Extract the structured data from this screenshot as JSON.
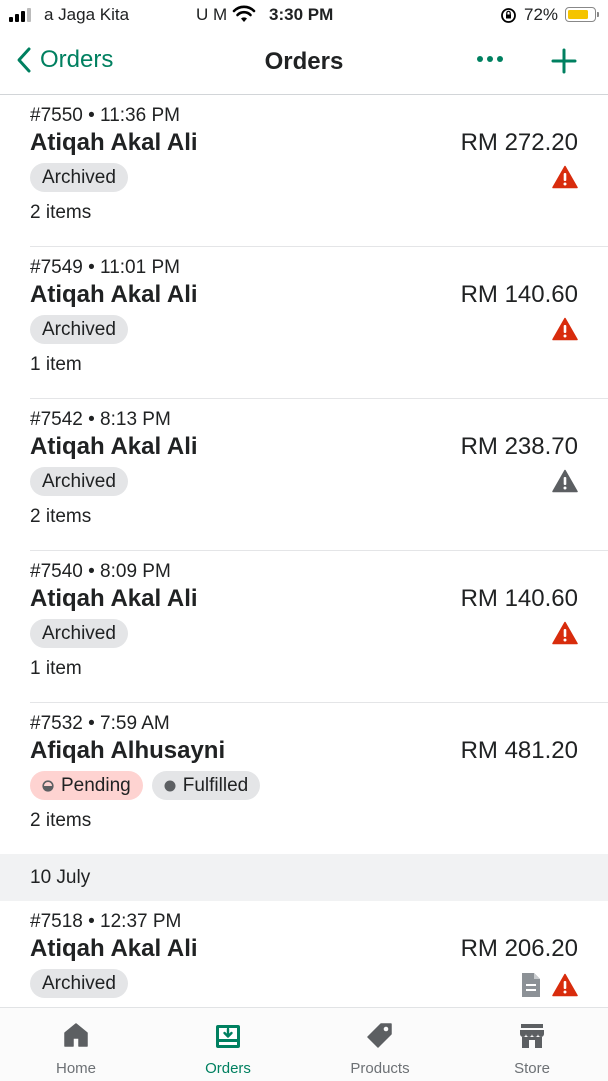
{
  "status_bar": {
    "carrier": "a Jaga Kita",
    "carrier_extra": "U M",
    "time": "3:30 PM",
    "battery": "72%",
    "icons": [
      "signal-icon",
      "wifi-icon",
      "orientation-lock-icon",
      "battery-icon"
    ]
  },
  "nav": {
    "back_label": "Orders",
    "title": "Orders",
    "icons": [
      "chevron-left-icon",
      "more-dots-icon",
      "plus-icon"
    ],
    "accent_color": "#008060"
  },
  "orders": [
    {
      "meta": "#7550 • 11:36 PM",
      "customer": "Atiqah Akal Ali",
      "total": "RM 272.20",
      "badges": [
        "Archived"
      ],
      "count": "2 items",
      "alert": "red"
    },
    {
      "meta": "#7549 • 11:01 PM",
      "customer": "Atiqah Akal Ali",
      "total": "RM 140.60",
      "badges": [
        "Archived"
      ],
      "count": "1 item",
      "alert": "red"
    },
    {
      "meta": "#7542 • 8:13 PM",
      "customer": "Atiqah Akal Ali",
      "total": "RM 238.70",
      "badges": [
        "Archived"
      ],
      "count": "2 items",
      "alert": "gray"
    },
    {
      "meta": "#7540 • 8:09 PM",
      "customer": "Atiqah Akal Ali",
      "total": "RM 140.60",
      "badges": [
        "Archived"
      ],
      "count": "1 item",
      "alert": "red"
    },
    {
      "meta": "#7532 • 7:59 AM",
      "customer": "Afiqah Alhusayni",
      "total": "RM 481.20",
      "badges": [
        "Pending",
        "Fulfilled"
      ],
      "count": "2 items",
      "alert": ""
    }
  ],
  "date_header": "10 July",
  "orders_after": [
    {
      "meta": "#7518 • 12:37 PM",
      "customer": "Atiqah Akal Ali",
      "total": "RM 206.20",
      "badges": [
        "Archived"
      ],
      "alert": "red",
      "note_icon": true
    }
  ],
  "tabs": [
    {
      "label": "Home",
      "icon": "home-icon",
      "active": false
    },
    {
      "label": "Orders",
      "icon": "orders-inbox-icon",
      "active": true
    },
    {
      "label": "Products",
      "icon": "tag-icon",
      "active": false
    },
    {
      "label": "Store",
      "icon": "store-icon",
      "active": false
    }
  ],
  "colors": {
    "alert_red": "#d82c0d",
    "alert_gray": "#5c5f62",
    "badge_gray": "#e4e5e7",
    "badge_pending": "#fed3d1"
  }
}
